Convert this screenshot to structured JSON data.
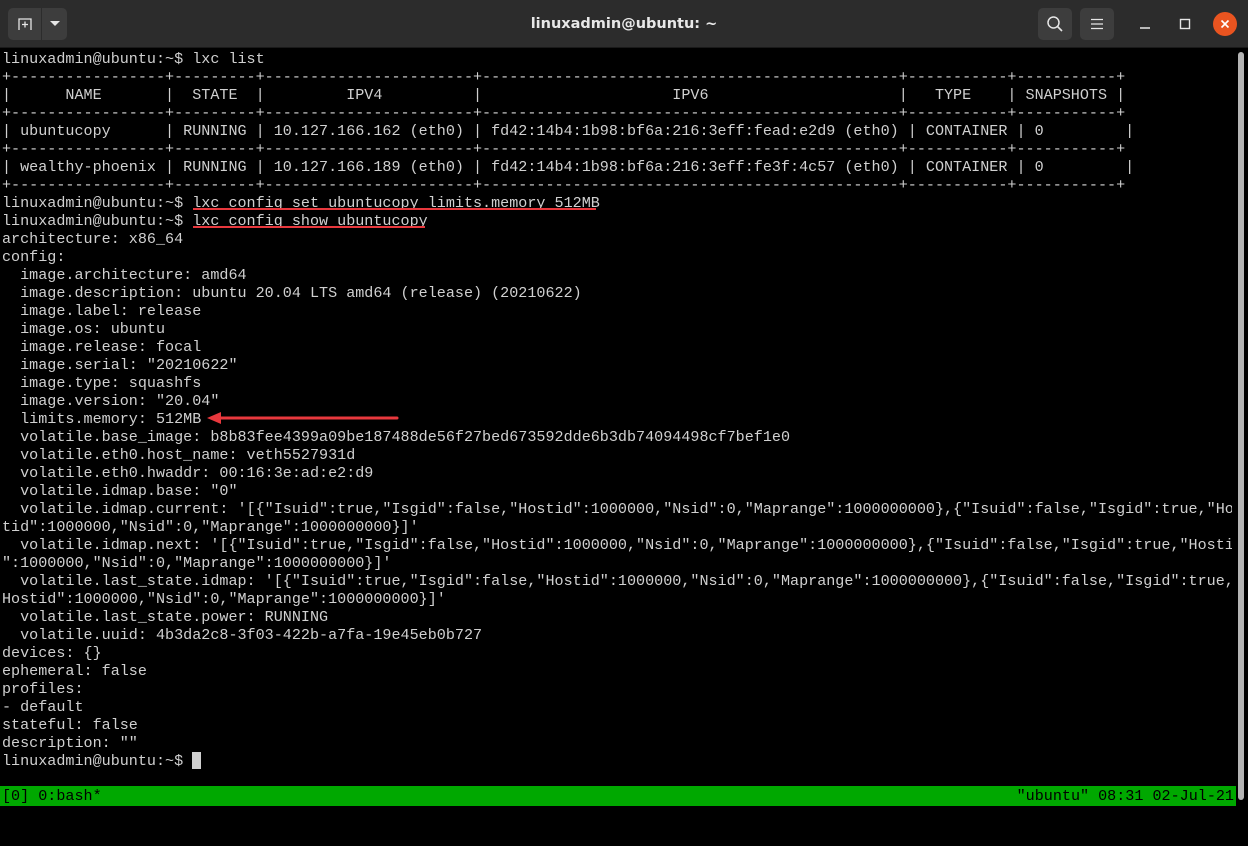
{
  "window": {
    "title": "linuxadmin@ubuntu: ~",
    "new_tab_icon": "new-tab-icon",
    "dropdown_icon": "chevron-down-icon",
    "search_icon": "search-icon",
    "menu_icon": "hamburger-menu-icon",
    "minimize_icon": "minimize-icon",
    "maximize_icon": "maximize-icon",
    "close_icon": "close-icon",
    "colors": {
      "close": "#e95420",
      "status_bar": "#00a800",
      "annotation": "#e8383d"
    }
  },
  "terminal": {
    "prompt": "linuxadmin@ubuntu:~$ ",
    "lines": [
      "linuxadmin@ubuntu:~$ lxc list",
      "+-----------------+---------+-----------------------+----------------------------------------------+-----------+-----------+",
      "|      NAME       |  STATE  |         IPV4          |                     IPV6                     |   TYPE    | SNAPSHOTS |",
      "+-----------------+---------+-----------------------+----------------------------------------------+-----------+-----------+",
      "| ubuntucopy      | RUNNING | 10.127.166.162 (eth0) | fd42:14b4:1b98:bf6a:216:3eff:fead:e2d9 (eth0) | CONTAINER | 0         |",
      "+-----------------+---------+-----------------------+----------------------------------------------+-----------+-----------+",
      "| wealthy-phoenix | RUNNING | 10.127.166.189 (eth0) | fd42:14b4:1b98:bf6a:216:3eff:fe3f:4c57 (eth0) | CONTAINER | 0         |",
      "+-----------------+---------+-----------------------+----------------------------------------------+-----------+-----------+",
      "linuxadmin@ubuntu:~$ lxc config set ubuntucopy limits.memory 512MB",
      "linuxadmin@ubuntu:~$ lxc config show ubuntucopy",
      "architecture: x86_64",
      "config:",
      "  image.architecture: amd64",
      "  image.description: ubuntu 20.04 LTS amd64 (release) (20210622)",
      "  image.label: release",
      "  image.os: ubuntu",
      "  image.release: focal",
      "  image.serial: \"20210622\"",
      "  image.type: squashfs",
      "  image.version: \"20.04\"",
      "  limits.memory: 512MB",
      "  volatile.base_image: b8b83fee4399a09be187488de56f27bed673592dde6b3db74094498cf7bef1e0",
      "  volatile.eth0.host_name: veth5527931d",
      "  volatile.eth0.hwaddr: 00:16:3e:ad:e2:d9",
      "  volatile.idmap.base: \"0\"",
      "  volatile.idmap.current: '[{\"Isuid\":true,\"Isgid\":false,\"Hostid\":1000000,\"Nsid\":0,\"Maprange\":1000000000},{\"Isuid\":false,\"Isgid\":true,\"Hos",
      "tid\":1000000,\"Nsid\":0,\"Maprange\":1000000000}]'",
      "  volatile.idmap.next: '[{\"Isuid\":true,\"Isgid\":false,\"Hostid\":1000000,\"Nsid\":0,\"Maprange\":1000000000},{\"Isuid\":false,\"Isgid\":true,\"Hostid",
      "\":1000000,\"Nsid\":0,\"Maprange\":1000000000}]'",
      "  volatile.last_state.idmap: '[{\"Isuid\":true,\"Isgid\":false,\"Hostid\":1000000,\"Nsid\":0,\"Maprange\":1000000000},{\"Isuid\":false,\"Isgid\":true,\"",
      "Hostid\":1000000,\"Nsid\":0,\"Maprange\":1000000000}]'",
      "  volatile.last_state.power: RUNNING",
      "  volatile.uuid: 4b3da2c8-3f03-422b-a7fa-19e45eb0b727",
      "devices: {}",
      "ephemeral: false",
      "profiles:",
      "- default",
      "stateful: false",
      "description: \"\"",
      "linuxadmin@ubuntu:~$ "
    ]
  },
  "status_bar": {
    "left": "[0] 0:bash*",
    "right": "\"ubuntu\" 08:31 02-Jul-21"
  }
}
